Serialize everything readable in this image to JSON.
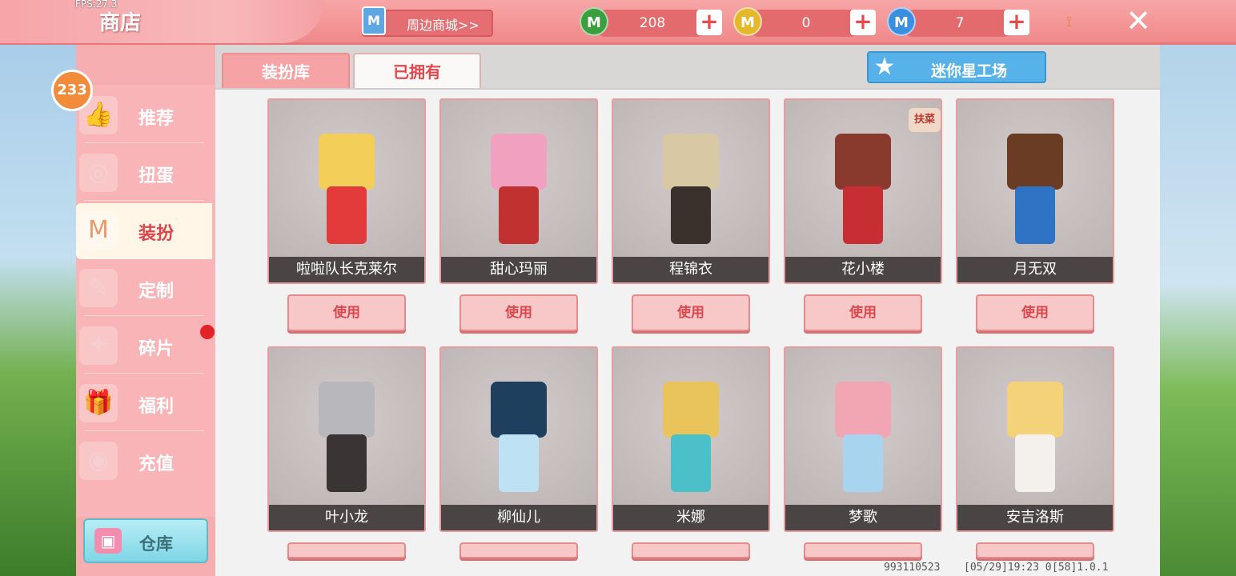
{
  "topbar": {
    "fps": "FPS:27.3",
    "title": "商店",
    "mall_label": "周边商城>>",
    "mall_icon": "shopping-bag-icon",
    "currencies": [
      {
        "name": "mini-bean",
        "value": "208",
        "icon": "M",
        "color": "#3a9f3c"
      },
      {
        "name": "mini-coin",
        "value": "0",
        "icon": "M",
        "color": "#e5b72a"
      },
      {
        "name": "mini-diamond",
        "value": "7",
        "icon": "M",
        "color": "#3b8fe0"
      }
    ],
    "plus": "+",
    "close": "✕",
    "rss": "⟟"
  },
  "sidebar": {
    "badge": "233",
    "items": [
      {
        "label": "推荐",
        "icon": "thumb-up-icon"
      },
      {
        "label": "扭蛋",
        "icon": "gacha-icon"
      },
      {
        "label": "装扮",
        "icon": "shirt-icon"
      },
      {
        "label": "定制",
        "icon": "pencil-ruler-icon"
      },
      {
        "label": "碎片",
        "icon": "fragment-icon"
      },
      {
        "label": "福利",
        "icon": "gift-icon"
      },
      {
        "label": "充值",
        "icon": "coins-icon"
      }
    ],
    "active_index": 2,
    "warehouse_label": "仓库"
  },
  "main": {
    "tabs": [
      {
        "label": "装扮库"
      },
      {
        "label": "已拥有"
      }
    ],
    "workshop_label": "迷你星工场",
    "use_label": "使用",
    "tag_text": "扶菜",
    "cards": [
      {
        "name": "啦啦队长克莱尔",
        "hair": "#f3cf5a",
        "outfit": "#e33b3b"
      },
      {
        "name": "甜心玛丽",
        "hair": "#f1a0c0",
        "outfit": "#c0312f"
      },
      {
        "name": "程锦衣",
        "hair": "#d8c9a4",
        "outfit": "#3a302c"
      },
      {
        "name": "花小楼",
        "hair": "#8a3a2c",
        "outfit": "#c72e34"
      },
      {
        "name": "月无双",
        "hair": "#6a3c24",
        "outfit": "#2f74c4"
      },
      {
        "name": "叶小龙",
        "hair": "#b8b8bc",
        "outfit": "#3b3434"
      },
      {
        "name": "柳仙儿",
        "hair": "#1f3f5e",
        "outfit": "#bfe1f4"
      },
      {
        "name": "米娜",
        "hair": "#e9c45a",
        "outfit": "#4bc0c9"
      },
      {
        "name": "梦歌",
        "hair": "#f2a5b3",
        "outfit": "#a9d4f0"
      },
      {
        "name": "安吉洛斯",
        "hair": "#f4d279",
        "outfit": "#f4f1ec"
      }
    ]
  },
  "status": {
    "uid": "993110523",
    "info": "[05/29]19:23 0",
    "version": "[58]1.0.1"
  }
}
